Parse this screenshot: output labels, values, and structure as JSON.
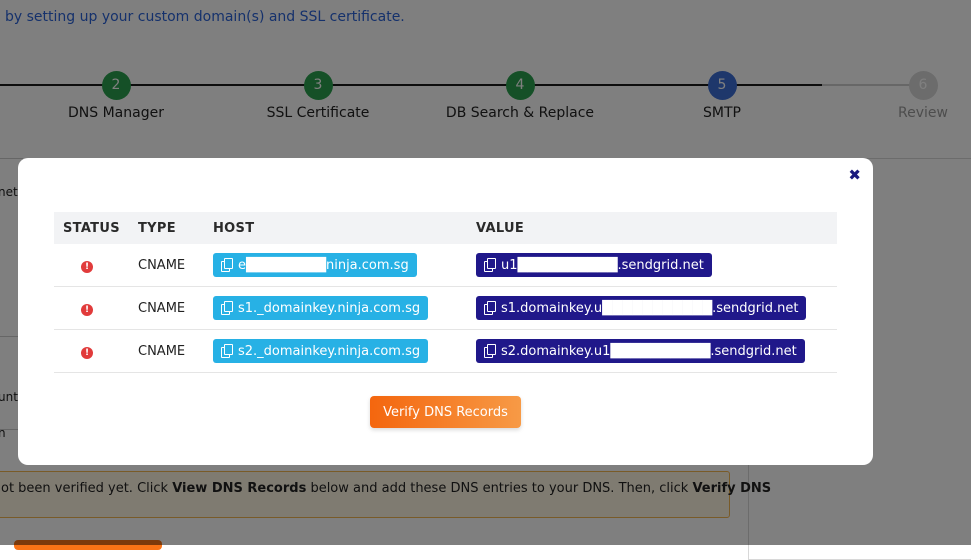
{
  "page": {
    "intro": "by setting up your custom domain(s) and SSL certificate.",
    "steps": [
      {
        "number": "2",
        "label": "DNS Manager",
        "state": "done"
      },
      {
        "number": "3",
        "label": "SSL Certificate",
        "state": "done"
      },
      {
        "number": "4",
        "label": "DB Search & Replace",
        "state": "done"
      },
      {
        "number": "5",
        "label": "SMTP",
        "state": "active"
      },
      {
        "number": "6",
        "label": "Review",
        "state": "pending"
      }
    ],
    "side_fragments": [
      "neth",
      "unt",
      "n"
    ],
    "notice": {
      "part1": "ot been verified yet. Click ",
      "bold1": "View DNS Records",
      "part2": " below and add these DNS entries to your DNS. Then, click ",
      "bold2": "Verify DNS"
    }
  },
  "modal": {
    "close_glyph": "✖",
    "columns": [
      "STATUS",
      "TYPE",
      "HOST",
      "VALUE"
    ],
    "status_glyph": "!",
    "rows": [
      {
        "type": "CNAME",
        "host": "e████████ninja.com.sg",
        "value": "u1██████████.sendgrid.net"
      },
      {
        "type": "CNAME",
        "host": "s1._domainkey.ninja.com.sg",
        "value": "s1.domainkey.u███████████.sendgrid.net"
      },
      {
        "type": "CNAME",
        "host": "s2._domainkey.ninja.com.sg",
        "value": "s2.domainkey.u1██████████.sendgrid.net"
      }
    ],
    "verify_button": "Verify DNS Records"
  },
  "colors": {
    "step_done": "#2aa14f",
    "step_active": "#3c6fd6",
    "host_pill": "#27b1e5",
    "value_pill": "#20188a",
    "status_error": "#e13b3b",
    "verify_button": "#f4660e"
  }
}
